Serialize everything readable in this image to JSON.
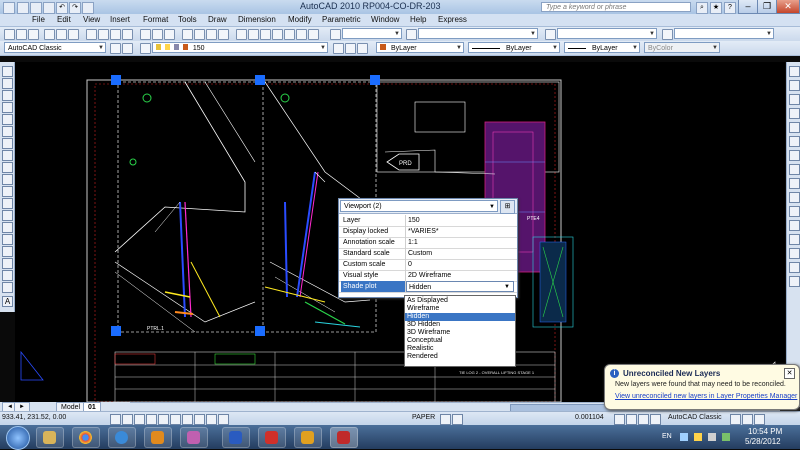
{
  "window": {
    "title": "AutoCAD 2010    RP004-CO-DR-203",
    "search_placeholder": "Type a keyword or phrase"
  },
  "menu": [
    "File",
    "Edit",
    "View",
    "Insert",
    "Format",
    "Tools",
    "Draw",
    "Dimension",
    "Modify",
    "Parametric",
    "Window",
    "Help",
    "Express"
  ],
  "toolbar": {
    "workspace": "AutoCAD Classic",
    "layer": "150",
    "color": "ByLayer",
    "linetype": "ByLayer",
    "lineweight": "ByLayer",
    "plotstyle": "ByColor"
  },
  "drawing": {
    "arrow_label": "PRD",
    "label_left": "PTRL.1",
    "label_right": "PTE4",
    "title_block": "TIE LOG 2 - OVERALL LIFTING STAGE 1"
  },
  "properties": {
    "selection": "Viewport (2)",
    "rows": [
      {
        "key": "Layer",
        "value": "150"
      },
      {
        "key": "Display locked",
        "value": "*VARIES*"
      },
      {
        "key": "Annotation scale",
        "value": "1:1"
      },
      {
        "key": "Standard scale",
        "value": "Custom"
      },
      {
        "key": "Custom scale",
        "value": "0"
      },
      {
        "key": "Visual style",
        "value": "2D Wireframe"
      },
      {
        "key": "Shade plot",
        "value": "Hidden"
      }
    ],
    "shade_plot_options": [
      "As Displayed",
      "Wireframe",
      "Hidden",
      "3D Hidden",
      "3D Wireframe",
      "Conceptual",
      "Realistic",
      "Rendered"
    ],
    "highlighted_option": "Hidden"
  },
  "tabs": [
    "Model",
    "01"
  ],
  "status": {
    "coords": "933.41, 231.52, 0.00",
    "paper": "PAPER",
    "scale": "0.001104",
    "workspace": "AutoCAD Classic"
  },
  "balloon": {
    "title": "Unreconciled New Layers",
    "message": "New layers were found that may need to be reconciled.",
    "link": "View unreconciled new layers in Layer Properties Manager"
  },
  "taskbar": {
    "lang": "EN",
    "time": "10:54 PM",
    "date": "5/28/2012"
  },
  "colors": {
    "grip": "#1a6cff",
    "selection_blue": "#3a75c4",
    "canvas": "#000000"
  }
}
